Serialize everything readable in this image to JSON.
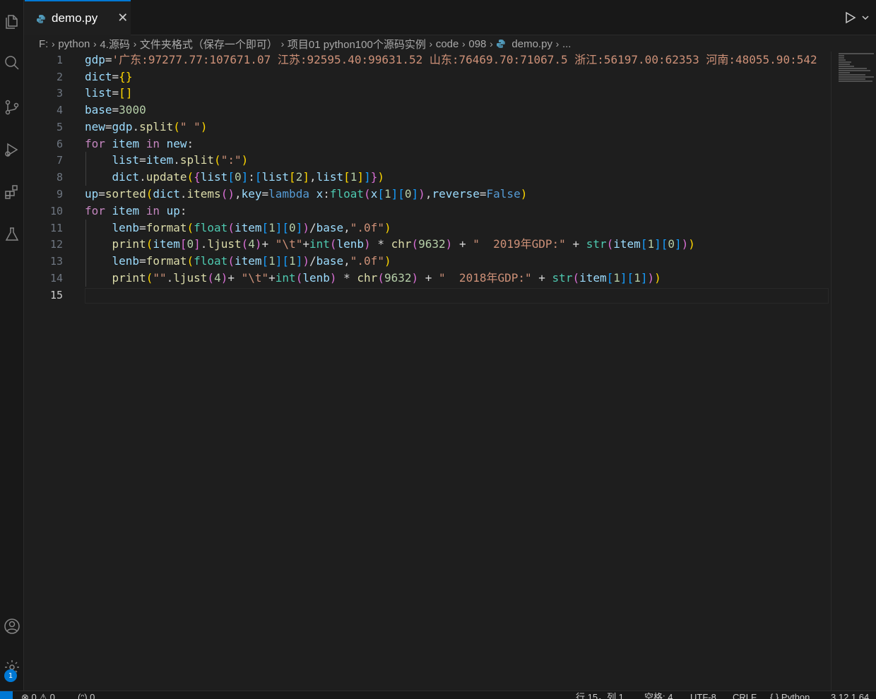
{
  "tab": {
    "label": "demo.py",
    "close": "✕",
    "icon": "python-file-icon"
  },
  "breadcrumb": [
    "F:",
    "python",
    "4.源码",
    "文件夹格式（保存一个即可）",
    "项目01 python100个源码实例",
    "code",
    "098",
    "demo.py",
    "..."
  ],
  "editor": {
    "line_numbers": [
      "1",
      "2",
      "3",
      "4",
      "5",
      "6",
      "7",
      "8",
      "9",
      "10",
      "11",
      "12",
      "13",
      "14",
      "15"
    ],
    "active_line": "15",
    "code_lines": [
      "gdp='广东:97277.77:107671.07 江苏:92595.40:99631.52 山东:76469.70:71067.5 浙江:56197.00:62353 河南:48055.90:542",
      "dict={}",
      "list=[]",
      "base=3000",
      "new=gdp.split(\" \")",
      "for item in new:",
      "    list=item.split(\":\")",
      "    dict.update({list[0]:[list[2],list[1]]})",
      "up=sorted(dict.items(),key=lambda x:float(x[1][0]),reverse=False)",
      "for item in up:",
      "    lenb=format(float(item[1][0])/base,\".0f\")",
      "    print(item[0].ljust(4)+ \"\\t\"+int(lenb) * chr(9632) + \"  2019年GDP:\" + str(item[1][0]))",
      "    lenb=format(float(item[1][1])/base,\".0f\")",
      "    print(\"\".ljust(4)+ \"\\t\"+int(lenb) * chr(9632) + \"  2018年GDP:\" + str(item[1][1]))",
      ""
    ]
  },
  "activity_bar": {
    "icons": [
      "explorer-icon",
      "search-icon",
      "source-control-icon",
      "run-debug-icon",
      "extensions-icon",
      "testing-icon",
      "account-icon",
      "manage-gear-icon"
    ],
    "badge": "1"
  },
  "status_bar": {
    "problems": "⊗ 0 ⚠ 0",
    "ports": "(ᵔ) 0",
    "cursor": "行 15，列 1",
    "spaces": "空格: 4",
    "encoding": "UTF-8",
    "eol": "CRLF",
    "language": "{ } Python",
    "interpreter": "3.12.1 64"
  },
  "colors": {
    "accent": "#0078d4",
    "background": "#1e1e1e"
  }
}
